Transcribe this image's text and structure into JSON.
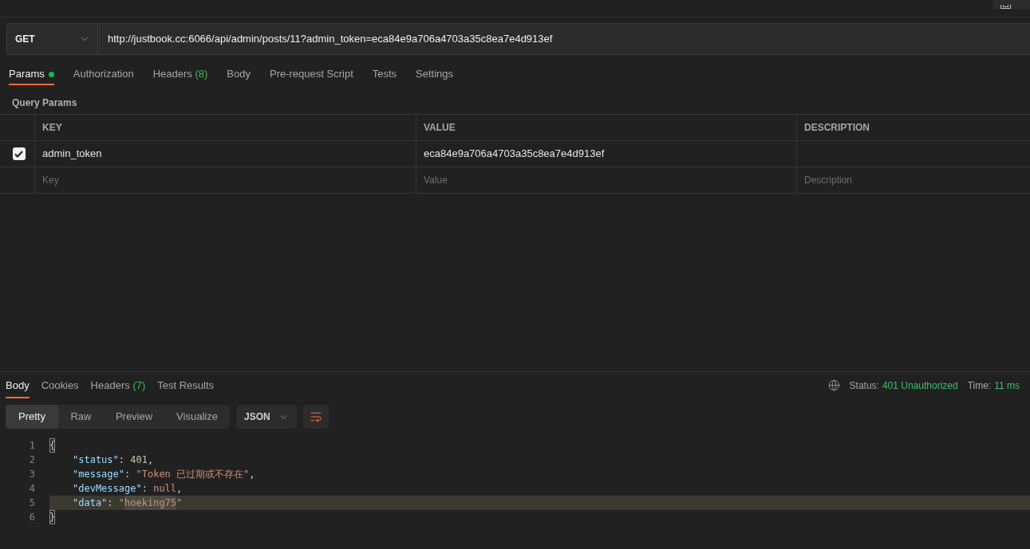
{
  "request": {
    "method": "GET",
    "url": "http://justbook.cc:6066/api/admin/posts/11?admin_token=eca84e9a706a4703a35c8ea7e4d913ef"
  },
  "request_tabs": [
    {
      "label": "Params",
      "selected": true,
      "indicator": true
    },
    {
      "label": "Authorization",
      "selected": false,
      "indicator": false
    },
    {
      "label": "Headers",
      "count": "(8)",
      "selected": false,
      "indicator": false
    },
    {
      "label": "Body",
      "selected": false,
      "indicator": false
    },
    {
      "label": "Pre-request Script",
      "selected": false,
      "indicator": false
    },
    {
      "label": "Tests",
      "selected": false,
      "indicator": false
    },
    {
      "label": "Settings",
      "selected": false,
      "indicator": false
    }
  ],
  "query_params": {
    "title": "Query Params",
    "columns": [
      "KEY",
      "VALUE",
      "DESCRIPTION"
    ],
    "rows": [
      {
        "checked": true,
        "key": "admin_token",
        "value": "eca84e9a706a4703a35c8ea7e4d913ef"
      }
    ],
    "new_row": {
      "key_placeholder": "Key",
      "value_placeholder": "Value",
      "description_placeholder": "Description"
    }
  },
  "response": {
    "tabs": [
      {
        "label": "Body",
        "selected": true
      },
      {
        "label": "Cookies",
        "selected": false
      },
      {
        "label": "Headers",
        "count": "(7)",
        "selected": false
      },
      {
        "label": "Test Results",
        "selected": false
      }
    ],
    "status": {
      "label": "Status:",
      "value": "401 Unauthorized"
    },
    "time": {
      "label": "Time:",
      "value": "11 ms"
    },
    "view_modes": [
      {
        "label": "Pretty",
        "selected": true
      },
      {
        "label": "Raw",
        "selected": false
      },
      {
        "label": "Preview",
        "selected": false
      },
      {
        "label": "Visualize",
        "selected": false
      }
    ],
    "format": "JSON",
    "code_lines": [
      {
        "number": "1",
        "current": false,
        "tokens": [
          {
            "kind": "bracket",
            "text": "{",
            "highlighted": true
          }
        ],
        "children": [
          {
            "number": "2",
            "current": false,
            "tokens": [
              {
                "kind": "key",
                "text": "\"status\"",
                "highlighted": false
              },
              {
                "kind": "punct",
                "text": ": ",
                "highlighted": false
              },
              {
                "kind": "number",
                "text": "401",
                "highlighted": false
              },
              {
                "kind": "punct",
                "text": ",",
                "highlighted": false
              }
            ]
          },
          {
            "number": "3",
            "current": false,
            "tokens": [
              {
                "kind": "key",
                "text": "\"message\"",
                "highlighted": false
              },
              {
                "kind": "punct",
                "text": ": ",
                "highlighted": false
              },
              {
                "kind": "string",
                "text": "\"Token 已过期或不存在\"",
                "highlighted": false
              },
              {
                "kind": "punct",
                "text": ",",
                "highlighted": false
              }
            ]
          },
          {
            "number": "4",
            "current": false,
            "tokens": [
              {
                "kind": "key",
                "text": "\"devMessage\"",
                "highlighted": false
              },
              {
                "kind": "punct",
                "text": ": ",
                "highlighted": false
              },
              {
                "kind": "null",
                "text": "null",
                "highlighted": false
              },
              {
                "kind": "punct",
                "text": ",",
                "highlighted": false
              }
            ]
          },
          {
            "number": "5",
            "current": true,
            "tokens": [
              {
                "kind": "key",
                "text": "\"data\"",
                "highlighted": false
              },
              {
                "kind": "punct",
                "text": ": ",
                "highlighted": false
              },
              {
                "kind": "string",
                "text": "\"",
                "highlighted": false
              },
              {
                "kind": "string",
                "text": "hoeking75",
                "highlighted": true
              },
              {
                "kind": "string",
                "text": "\"",
                "highlighted": false
              }
            ]
          }
        ]
      },
      {
        "number": "6",
        "current": false,
        "tokens": [
          {
            "kind": "bracket",
            "text": "}",
            "highlighted": true
          }
        ]
      }
    ]
  }
}
